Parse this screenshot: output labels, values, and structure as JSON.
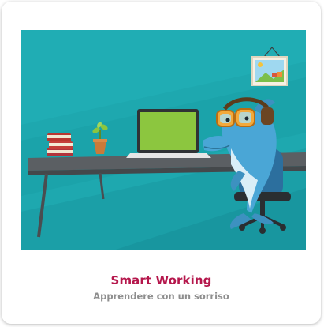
{
  "card": {
    "title": "Smart Working",
    "subtitle": "Apprendere con un sorriso"
  },
  "colors": {
    "title": "#b5174c",
    "subtitle": "#8e8e8e",
    "background_teal": "#1fa9b0",
    "desk": "#55595c",
    "laptop_screen": "#8cc63f"
  },
  "illustration": {
    "scene": "dolphin-working-at-desk",
    "elements": [
      "framed-landscape-picture",
      "stacked-books",
      "potted-plant",
      "laptop",
      "dolphin-with-headphones",
      "office-chair",
      "desk"
    ]
  }
}
